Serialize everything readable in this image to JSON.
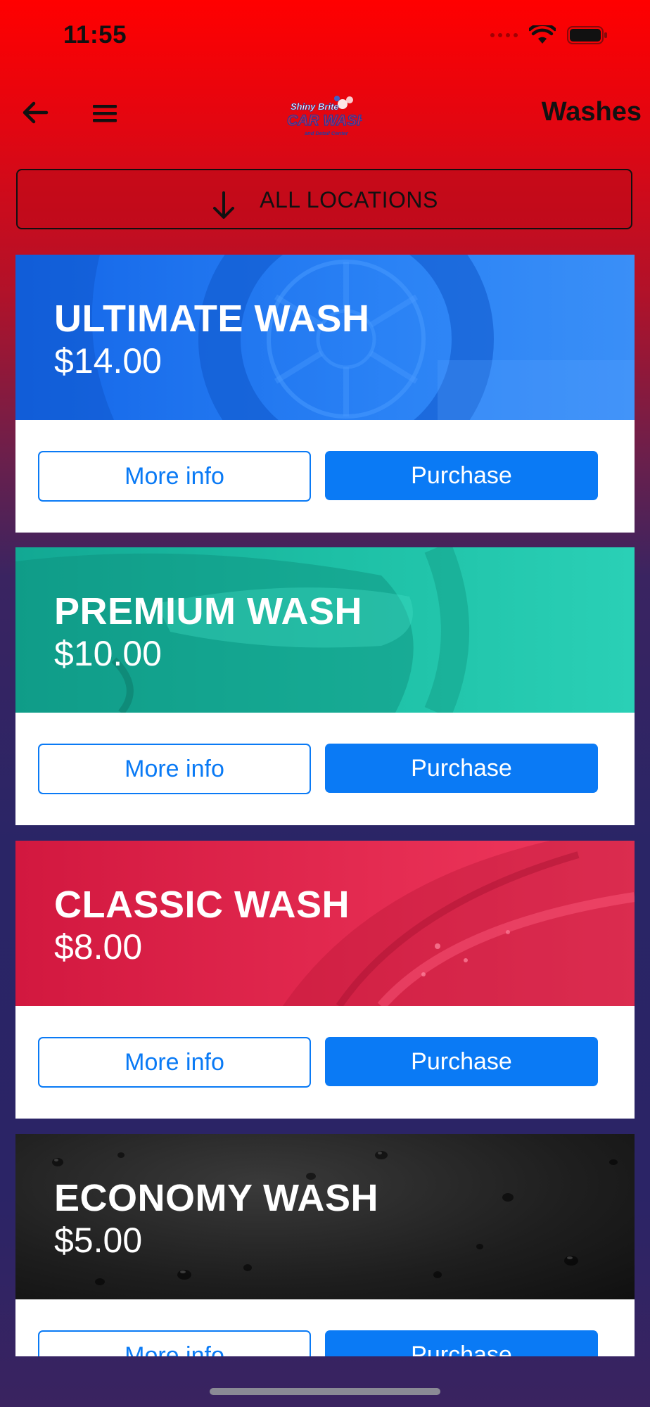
{
  "status_bar": {
    "time": "11:55"
  },
  "nav": {
    "title": "Washes",
    "logo_alt": "Shiny Brite Car Wash and Detail Center"
  },
  "locations": {
    "label": "ALL LOCATIONS"
  },
  "colors": {
    "primary": "#0a7af5",
    "ultimate": "#1f78f0",
    "premium": "#22c6ab",
    "classic": "#e42d4f",
    "economy": "#1b1b1b"
  },
  "washes": [
    {
      "title": "ULTIMATE WASH",
      "price": "$14.00",
      "more_info": "More info",
      "purchase": "Purchase"
    },
    {
      "title": "PREMIUM WASH",
      "price": "$10.00",
      "more_info": "More info",
      "purchase": "Purchase"
    },
    {
      "title": "CLASSIC WASH",
      "price": "$8.00",
      "more_info": "More info",
      "purchase": "Purchase"
    },
    {
      "title": "ECONOMY WASH",
      "price": "$5.00",
      "more_info": "More info",
      "purchase": "Purchase"
    }
  ]
}
